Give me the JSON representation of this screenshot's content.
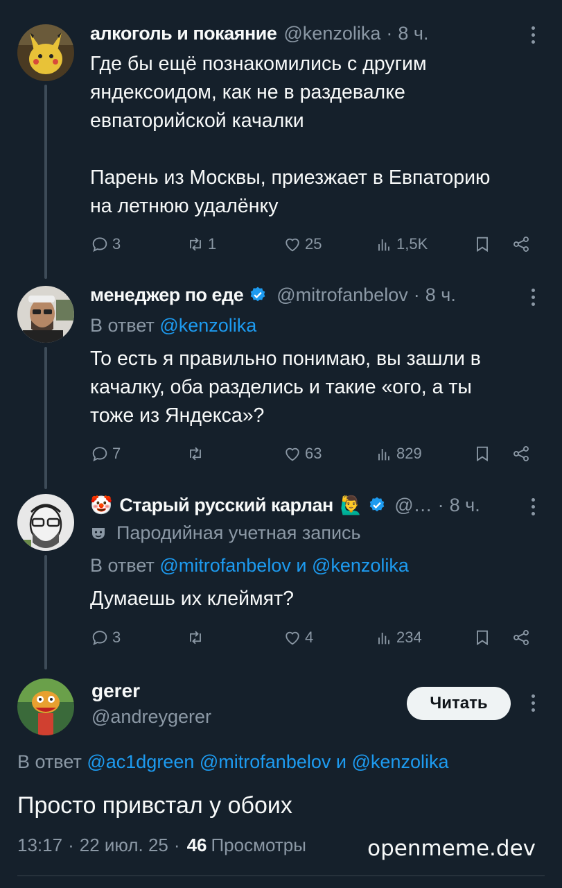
{
  "tweets": [
    {
      "name": "алкоголь и покаяние",
      "handle": "@kenzolika",
      "time": "8 ч.",
      "text": "Где бы ещё познакомились с другим\nяндексоидом, как не в раздевалке\nевпаторийской качалки\n\nПарень из Москвы, приезжает в Евпаторию\nна летнюю удалёнку",
      "replies": "3",
      "retweets": "1",
      "likes": "25",
      "views": "1,5K"
    },
    {
      "name": "менеджер по еде",
      "handle": "@mitrofanbelov",
      "time": "8 ч.",
      "reply_prefix": "В ответ",
      "reply_to": "@kenzolika",
      "text": "То есть я правильно понимаю, вы зашли в\nкачалку, оба разделись и такие «ого, а ты\nтоже из Яндекса»?",
      "replies": "7",
      "retweets": "",
      "likes": "63",
      "views": "829"
    },
    {
      "name_emoji": "🤡",
      "name": "Старый русский карлан",
      "name_emoji2": "🙋‍♂️",
      "handle": "@…",
      "time": "8 ч.",
      "parody_label": "Пародийная учетная запись",
      "reply_prefix": "В ответ",
      "reply_to_1": "@mitrofanbelov",
      "reply_and": "и",
      "reply_to_2": "@kenzolika",
      "text": "Думаешь их клеймят?",
      "replies": "3",
      "retweets": "",
      "likes": "4",
      "views": "234"
    }
  ],
  "main": {
    "name": "gerer",
    "handle": "@andreygerer",
    "follow_label": "Читать",
    "reply_prefix": "В ответ",
    "reply_to_1": "@ac1dgreen",
    "reply_to_2": "@mitrofanbelov",
    "reply_and": "и",
    "reply_to_3": "@kenzolika",
    "text": "Просто привстал у обоих",
    "time": "13:17",
    "date": "22 июл. 25",
    "views_count": "46",
    "views_label": "Просмотры"
  },
  "watermark": "openmeme.dev",
  "colors": {
    "background": "#15202b",
    "text": "#f7f9f9",
    "muted": "#8b98a5",
    "link": "#1d9bf0",
    "verified": "#1d9bf0"
  }
}
